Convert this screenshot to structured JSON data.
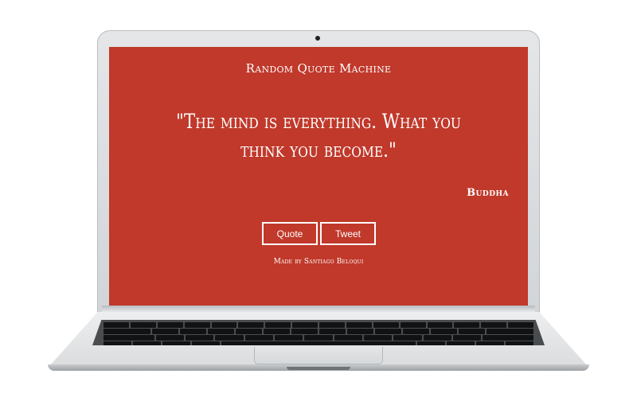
{
  "app": {
    "title": "Random Quote Machine"
  },
  "quote": {
    "text": "\"The mind is everything. What you think you become.\"",
    "author": "Buddha"
  },
  "buttons": {
    "quote_label": "Quote",
    "tweet_label": "Tweet"
  },
  "footer": {
    "credit": "Made by Santiago Beloqui"
  },
  "colors": {
    "background": "#c0392b",
    "text": "#ffffff"
  }
}
